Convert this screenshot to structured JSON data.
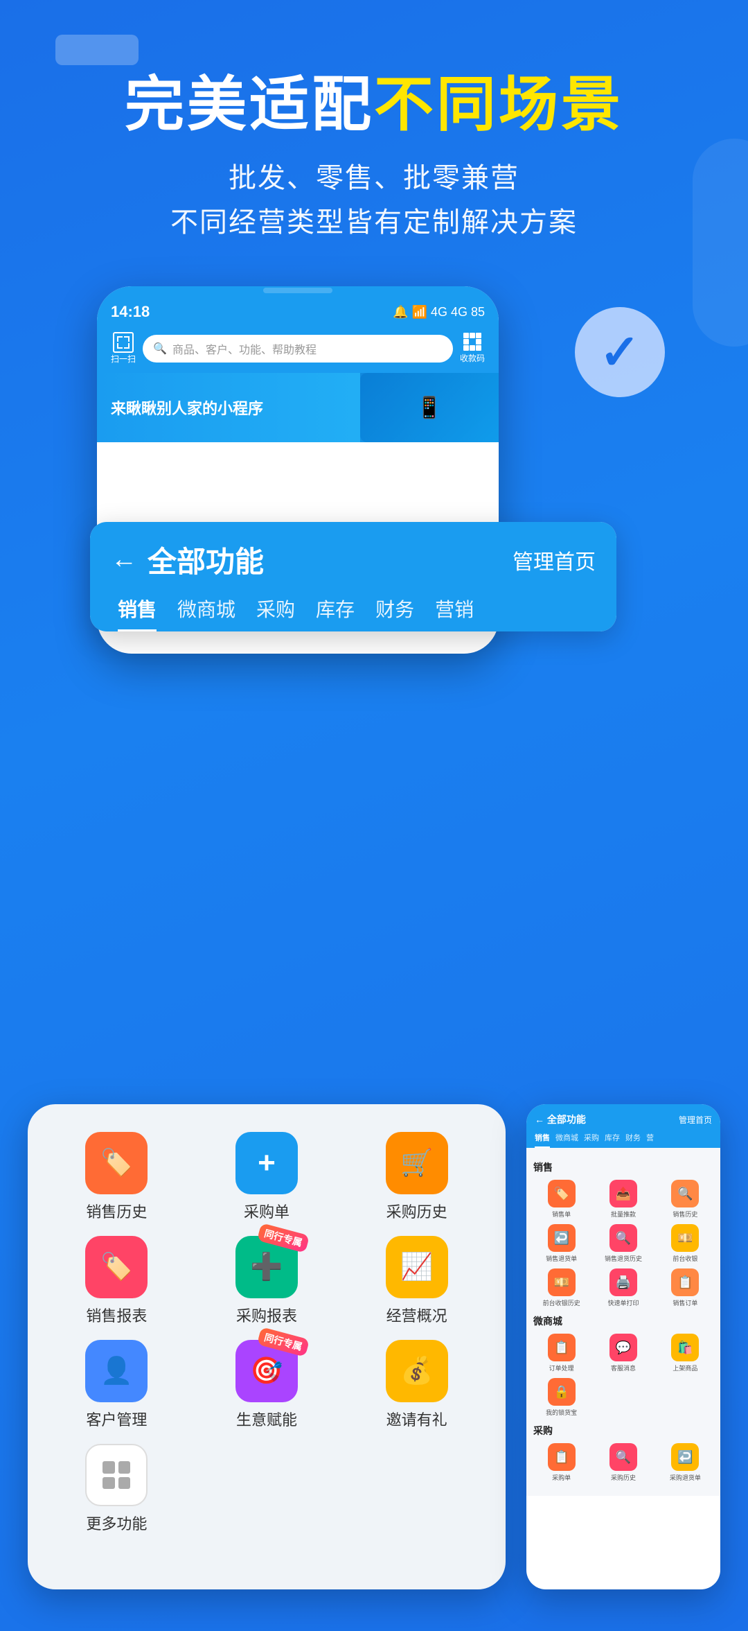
{
  "hero": {
    "title_part1": "完美适配",
    "title_highlight": "不同场景",
    "subtitle_line1": "批发、零售、批零兼营",
    "subtitle_line2": "不同经营类型皆有定制解决方案"
  },
  "phone_mockup": {
    "time": "14:18",
    "status_icons": "🔔📶4G",
    "search_placeholder": "商品、客户、功能、帮助教程",
    "scan_label": "扫一扫",
    "qr_label": "收款码",
    "banner_text": "来瞅瞅别人家的小程序"
  },
  "function_card": {
    "back_label": "←",
    "title": "全部功能",
    "manage_home": "管理首页",
    "tabs": [
      {
        "label": "销售",
        "active": true
      },
      {
        "label": "微商城",
        "active": false
      },
      {
        "label": "采购",
        "active": false
      },
      {
        "label": "库存",
        "active": false
      },
      {
        "label": "财务",
        "active": false
      },
      {
        "label": "营销",
        "active": false
      }
    ]
  },
  "left_phone": {
    "icons": [
      {
        "label": "销售历史",
        "bg": "#FF6B35",
        "emoji": "🏷️"
      },
      {
        "label": "采购单",
        "bg": "#1a9cf0",
        "emoji": "➕"
      },
      {
        "label": "采购历史",
        "bg": "#FF8C00",
        "emoji": "🛒"
      },
      {
        "label": "销售报表",
        "bg": "#FF4466",
        "emoji": "🏷️"
      },
      {
        "label": "采购报表",
        "bg": "#00BB88",
        "emoji": "➕",
        "badge": "同行专属"
      },
      {
        "label": "经营概况",
        "bg": "#FFB800",
        "emoji": "📈"
      },
      {
        "label": "客户管理",
        "bg": "#4488FF",
        "emoji": "👤"
      },
      {
        "label": "生意赋能",
        "bg": "#AA44FF",
        "emoji": "🎯",
        "badge": "同行专属"
      },
      {
        "label": "邀请有礼",
        "bg": "#FFB800",
        "emoji": "💰"
      },
      {
        "label": "更多功能",
        "bg": "white",
        "emoji": "⊞",
        "is_more": true
      }
    ]
  },
  "right_phone": {
    "header": {
      "back": "←",
      "title": "全部功能",
      "manage": "管理首页",
      "tabs": [
        "销售",
        "微商城",
        "采购",
        "库存",
        "财务",
        "营销"
      ]
    },
    "sections": [
      {
        "title": "销售",
        "icons": [
          {
            "label": "销售单",
            "bg": "#FF6B35",
            "emoji": "🏷️"
          },
          {
            "label": "批量推款",
            "bg": "#FF4466",
            "emoji": "📤"
          },
          {
            "label": "销售历史",
            "bg": "#FF8844",
            "emoji": "🔍"
          },
          {
            "label": "销售退货单",
            "bg": "#FF6B35",
            "emoji": "↩️"
          },
          {
            "label": "销售退货历史",
            "bg": "#FF4466",
            "emoji": "🔍"
          },
          {
            "label": "前台收银",
            "bg": "#FFB800",
            "emoji": "💴"
          },
          {
            "label": "前台收银历史",
            "bg": "#FF6B35",
            "emoji": "💴"
          },
          {
            "label": "快速单打印",
            "bg": "#FF4466",
            "emoji": "🖨️"
          },
          {
            "label": "销售订单",
            "bg": "#FF8844",
            "emoji": "📋"
          }
        ]
      },
      {
        "title": "微商城",
        "icons": [
          {
            "label": "订单处理",
            "bg": "#FF6B35",
            "emoji": "📋"
          },
          {
            "label": "客服消息",
            "bg": "#FF4466",
            "emoji": "💬"
          },
          {
            "label": "上架商品",
            "bg": "#FFB800",
            "emoji": "🛍️"
          },
          {
            "label": "我的锁货宝",
            "bg": "#FF6B35",
            "emoji": "🔒"
          }
        ]
      },
      {
        "title": "采购",
        "icons": [
          {
            "label": "采购单",
            "bg": "#FF6B35",
            "emoji": "📋"
          },
          {
            "label": "采购历史",
            "bg": "#FF4466",
            "emoji": "🔍"
          },
          {
            "label": "采购退货单",
            "bg": "#FFB800",
            "emoji": "↩️"
          }
        ]
      }
    ]
  }
}
